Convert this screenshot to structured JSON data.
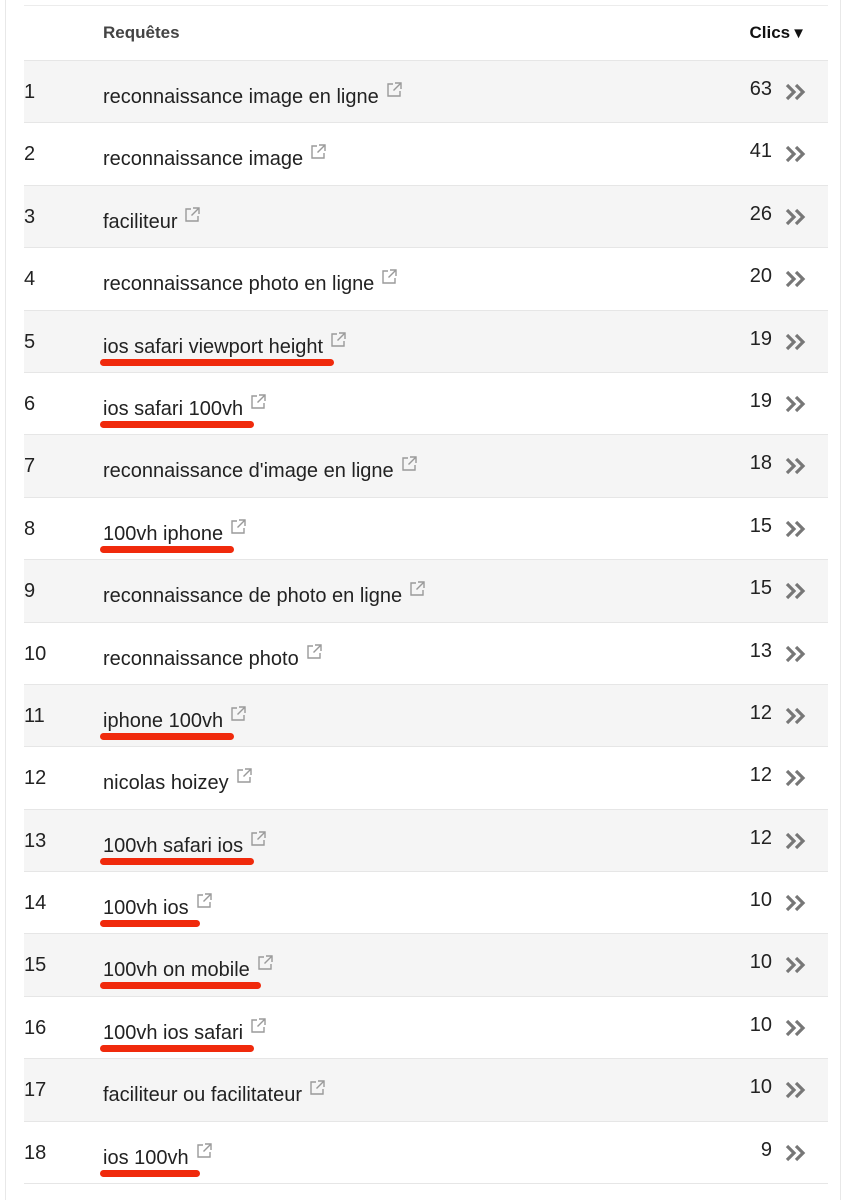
{
  "header": {
    "query_label": "Requêtes",
    "clicks_label": "Clics",
    "sort_indicator": "▼"
  },
  "rows": [
    {
      "rank": "1",
      "query": "reconnaissance image en ligne",
      "clicks": "63",
      "highlighted": false
    },
    {
      "rank": "2",
      "query": "reconnaissance image",
      "clicks": "41",
      "highlighted": false
    },
    {
      "rank": "3",
      "query": "faciliteur",
      "clicks": "26",
      "highlighted": false
    },
    {
      "rank": "4",
      "query": "reconnaissance photo en ligne",
      "clicks": "20",
      "highlighted": false
    },
    {
      "rank": "5",
      "query": "ios safari viewport height",
      "clicks": "19",
      "highlighted": true
    },
    {
      "rank": "6",
      "query": "ios safari 100vh",
      "clicks": "19",
      "highlighted": true
    },
    {
      "rank": "7",
      "query": "reconnaissance d'image en ligne",
      "clicks": "18",
      "highlighted": false
    },
    {
      "rank": "8",
      "query": "100vh iphone",
      "clicks": "15",
      "highlighted": true
    },
    {
      "rank": "9",
      "query": "reconnaissance de photo en ligne",
      "clicks": "15",
      "highlighted": false
    },
    {
      "rank": "10",
      "query": "reconnaissance photo",
      "clicks": "13",
      "highlighted": false
    },
    {
      "rank": "11",
      "query": "iphone 100vh",
      "clicks": "12",
      "highlighted": true
    },
    {
      "rank": "12",
      "query": "nicolas hoizey",
      "clicks": "12",
      "highlighted": false
    },
    {
      "rank": "13",
      "query": "100vh safari ios",
      "clicks": "12",
      "highlighted": true
    },
    {
      "rank": "14",
      "query": "100vh ios",
      "clicks": "10",
      "highlighted": true
    },
    {
      "rank": "15",
      "query": "100vh on mobile",
      "clicks": "10",
      "highlighted": true
    },
    {
      "rank": "16",
      "query": "100vh ios safari",
      "clicks": "10",
      "highlighted": true
    },
    {
      "rank": "17",
      "query": "faciliteur ou facilitateur",
      "clicks": "10",
      "highlighted": false
    },
    {
      "rank": "18",
      "query": "ios 100vh",
      "clicks": "9",
      "highlighted": true
    }
  ],
  "icons": {
    "external_link": "external-link-icon",
    "row_detail": "double-chevron-right-icon"
  },
  "colors": {
    "highlight_underline": "#f02a0c",
    "row_alt_background": "#f5f5f5",
    "icon_gray": "#9a9a9a",
    "chevron_gray": "#777777"
  }
}
